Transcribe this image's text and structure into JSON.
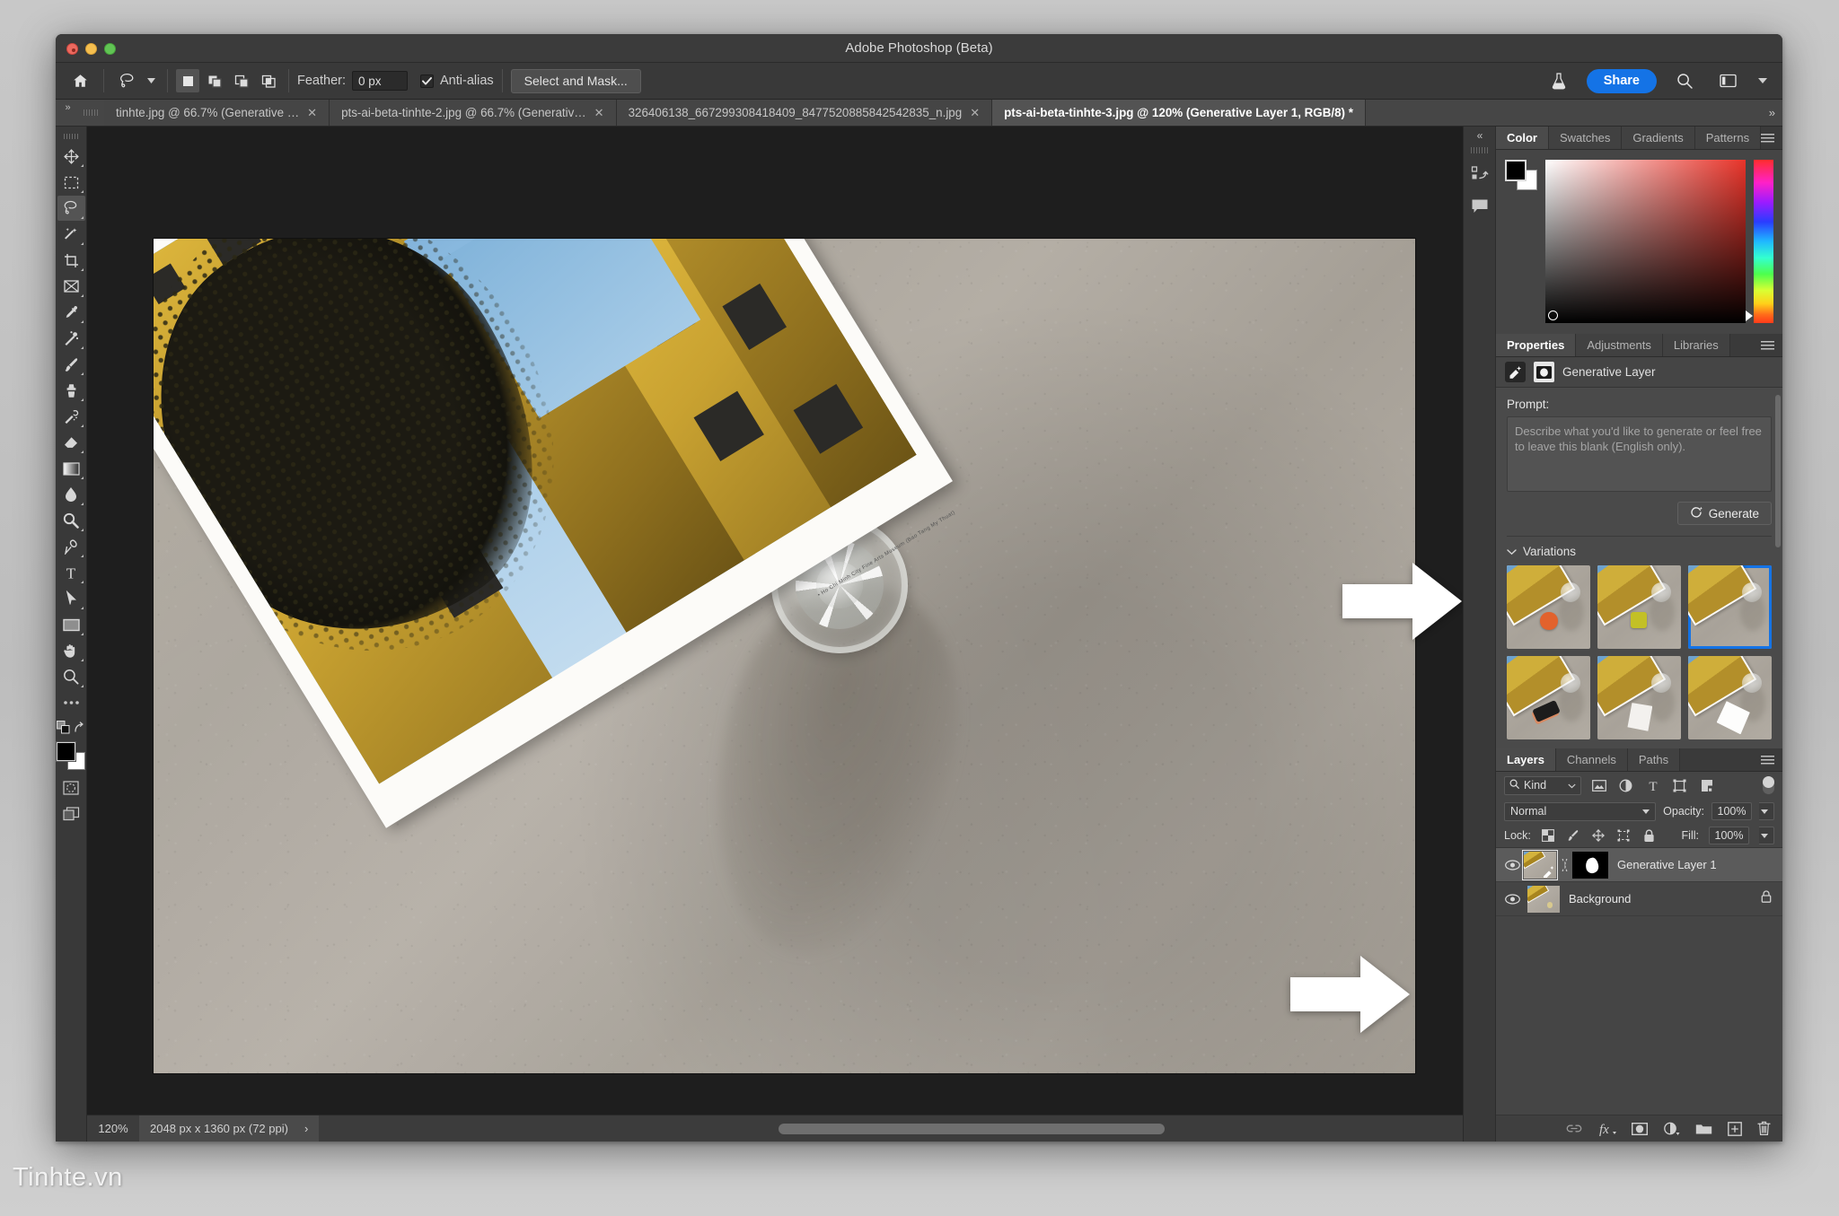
{
  "window": {
    "title": "Adobe Photoshop (Beta)",
    "traffic": {
      "close": "close-button",
      "minimize": "minimize-button",
      "zoom": "zoom-button"
    }
  },
  "options_bar": {
    "home_icon": "home-icon",
    "tool_icon": "lasso-tool-icon",
    "selection_modes": [
      "new-selection",
      "add-to-selection",
      "subtract-from-selection",
      "intersect-selection"
    ],
    "feather_label": "Feather:",
    "feather_value": "0 px",
    "antialias_label": "Anti-alias",
    "antialias_checked": true,
    "select_and_mask": "Select and Mask...",
    "lab_icon": "beta-flask-icon",
    "share_label": "Share",
    "search_icon": "search-icon",
    "workspace_icon": "workspace-icon",
    "chevron": "chevron-down-icon"
  },
  "tabs": {
    "overflow": "»",
    "items": [
      {
        "label": "tinhte.jpg @ 66.7% (Generative …",
        "active": false,
        "closable": true
      },
      {
        "label": "pts-ai-beta-tinhte-2.jpg @ 66.7% (Generativ…",
        "active": false,
        "closable": true
      },
      {
        "label": "326406138_667299308418409_8477520885842542835_n.jpg",
        "active": false,
        "closable": true
      },
      {
        "label": "pts-ai-beta-tinhte-3.jpg @ 120% (Generative Layer 1, RGB/8) *",
        "active": true,
        "closable": true
      }
    ]
  },
  "toolbar": {
    "tools": [
      "move-tool",
      "rectangular-marquee-tool",
      "lasso-tool",
      "object-selection-tool",
      "crop-tool",
      "frame-tool",
      "eyedropper-tool",
      "spot-healing-brush-tool",
      "brush-tool",
      "clone-stamp-tool",
      "history-brush-tool",
      "eraser-tool",
      "gradient-tool",
      "blur-tool",
      "dodge-tool",
      "pen-tool",
      "type-tool",
      "path-selection-tool",
      "shape-tool",
      "hand-tool",
      "zoom-tool",
      "edit-toolbar-tool"
    ],
    "active_tool": "lasso-tool",
    "quick-mask": "quick-mask-icon",
    "screen-mode": "screen-mode-icon",
    "default-colors": "default-colors-icon",
    "swap-colors": "swap-colors-icon",
    "foreground_color": "#000000",
    "background_color": "#ffffff"
  },
  "canvas": {
    "photo_caption": "• Ho Chi Minh City Fine Arts Museum (Bao Tang My Thuat)",
    "arrow_1": "annotation-arrow-to-prompt",
    "arrow_2": "annotation-arrow-to-layer"
  },
  "status_bar": {
    "zoom": "120%",
    "doc_size": "2048 px x 1360 px (72 ppi)",
    "expand": "›"
  },
  "rail": {
    "collapse": "«",
    "icons": [
      "history-icon",
      "comments-icon"
    ]
  },
  "color_panel": {
    "tabs": [
      {
        "label": "Color",
        "active": true
      },
      {
        "label": "Swatches",
        "active": false
      },
      {
        "label": "Gradients",
        "active": false
      },
      {
        "label": "Patterns",
        "active": false
      }
    ],
    "menu_icon": "panel-menu-icon",
    "foreground": "#000000",
    "background": "#ffffff",
    "accent_hue": "#e8342a"
  },
  "properties_panel": {
    "tabs": [
      {
        "label": "Properties",
        "active": true
      },
      {
        "label": "Adjustments",
        "active": false
      },
      {
        "label": "Libraries",
        "active": false
      }
    ],
    "menu_icon": "panel-menu-icon",
    "layer_type": "Generative Layer",
    "generative_icon": "generative-fill-icon",
    "mask_icon": "layer-mask-icon",
    "prompt_label": "Prompt:",
    "prompt_value": "",
    "prompt_placeholder": "Describe what you'd like to generate or feel free to leave this blank (English only).",
    "generate_label": "Generate",
    "generate_icon": "generate-sparkle-icon",
    "variations_label": "Variations",
    "variations_collapsed": false,
    "variations": [
      {
        "name": "variation-1",
        "selected": false,
        "object": "orange-bowl"
      },
      {
        "name": "variation-2",
        "selected": false,
        "object": "yellow-cube"
      },
      {
        "name": "variation-3",
        "selected": true,
        "object": "empty"
      },
      {
        "name": "variation-4",
        "selected": false,
        "object": "phone"
      },
      {
        "name": "variation-5",
        "selected": false,
        "object": "white-paper"
      },
      {
        "name": "variation-6",
        "selected": false,
        "object": "white-shape"
      }
    ]
  },
  "layers_panel": {
    "tabs": [
      {
        "label": "Layers",
        "active": true
      },
      {
        "label": "Channels",
        "active": false
      },
      {
        "label": "Paths",
        "active": false
      }
    ],
    "menu_icon": "panel-menu-icon",
    "filter_kind": "Kind",
    "filter_icons": [
      "pixel-filter-icon",
      "adjustment-filter-icon",
      "type-filter-icon",
      "shape-filter-icon",
      "smart-object-filter-icon"
    ],
    "filter_toggle": "filter-enable-toggle",
    "blend_mode": "Normal",
    "opacity_label": "Opacity:",
    "opacity_value": "100%",
    "lock_label": "Lock:",
    "lock_icons": [
      "lock-transparent-pixels-icon",
      "lock-image-pixels-icon",
      "lock-position-icon",
      "lock-artboard-nesting-icon",
      "lock-all-icon"
    ],
    "fill_label": "Fill:",
    "fill_value": "100%",
    "layers": [
      {
        "name": "Generative Layer 1",
        "visible": true,
        "selected": true,
        "has_mask": true,
        "locked": false
      },
      {
        "name": "Background",
        "visible": true,
        "selected": false,
        "has_mask": false,
        "locked": true
      }
    ],
    "footer_icons": [
      "link-layers-icon",
      "layer-styles-icon",
      "add-layer-mask-icon",
      "new-adjustment-layer-icon",
      "new-group-icon",
      "new-layer-icon",
      "delete-layer-icon"
    ]
  },
  "watermark": {
    "text": "Tinhte.vn"
  }
}
